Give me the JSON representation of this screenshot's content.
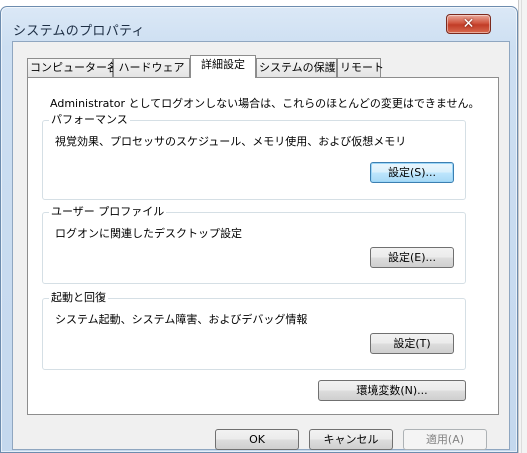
{
  "window": {
    "title": "システムのプロパティ",
    "close_glyph": "✕"
  },
  "tabs": [
    {
      "label": "コンピューター名",
      "active": false
    },
    {
      "label": "ハードウェア",
      "active": false
    },
    {
      "label": "詳細設定",
      "active": true
    },
    {
      "label": "システムの保護",
      "active": false
    },
    {
      "label": "リモート",
      "active": false
    }
  ],
  "advanced": {
    "admin_note": "Administrator としてログオンしない場合は、これらのほとんどの変更はできません。",
    "performance": {
      "label": "パフォーマンス",
      "description": "視覚効果、プロセッサのスケジュール、メモリ使用、および仮想メモリ",
      "button": "設定(S)..."
    },
    "user_profiles": {
      "label": "ユーザー プロファイル",
      "description": "ログオンに関連したデスクトップ設定",
      "button": "設定(E)..."
    },
    "startup_recovery": {
      "label": "起動と回復",
      "description": "システム起動、システム障害、およびデバッグ情報",
      "button": "設定(T)"
    },
    "env_button": "環境変数(N)..."
  },
  "footer": {
    "ok": "OK",
    "cancel": "キャンセル",
    "apply": "適用(A)"
  },
  "icons": {
    "close": "close-icon"
  },
  "colors": {
    "focus_border": "#3c7fb1",
    "close_red": "#c13c27",
    "frame_blue": "#cddff2"
  }
}
